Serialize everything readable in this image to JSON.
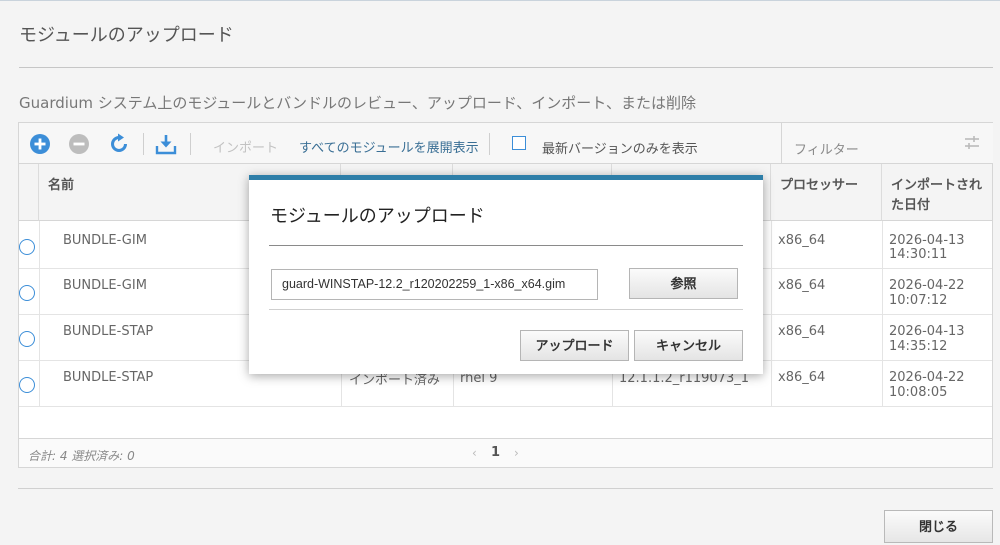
{
  "page": {
    "title": "モジュールのアップロード",
    "description": "Guardium システム上のモジュールとバンドルのレビュー、アップロード、インポート、または削除"
  },
  "toolbar": {
    "import_label": "インポート",
    "expand_all_label": "すべてのモジュールを展開表示",
    "latest_only_label": "最新バージョンのみを表示",
    "filter_placeholder": "フィルター",
    "icons": [
      "add-icon",
      "remove-icon",
      "refresh-icon",
      "download-icon",
      "filter-toggle-icon"
    ]
  },
  "table": {
    "columns": [
      "名前",
      "",
      "",
      "",
      "プロセッサー",
      "インポートされた日付"
    ],
    "rows": [
      {
        "name": "BUNDLE-GIM",
        "status": "",
        "os": "",
        "version": "",
        "processor": "x86_64",
        "date": "2026-04-13",
        "time": "14:30:11"
      },
      {
        "name": "BUNDLE-GIM",
        "status": "",
        "os": "",
        "version": "",
        "processor": "x86_64",
        "date": "2026-04-22",
        "time": "10:07:12"
      },
      {
        "name": "BUNDLE-STAP",
        "status": "",
        "os": "",
        "version": "",
        "processor": "x86_64",
        "date": "2026-04-13",
        "time": "14:35:12"
      },
      {
        "name": "BUNDLE-STAP",
        "status": "インポート済み",
        "os": "rhel 9",
        "version": "12.1.1.2_r119073_1",
        "processor": "x86_64",
        "date": "2026-04-22",
        "time": "10:08:05"
      }
    ]
  },
  "footer": {
    "summary": "合計: 4 選択済み: 0",
    "prev": "‹",
    "page": "1",
    "next": "›"
  },
  "close_button": "閉じる",
  "dialog": {
    "title": "モジュールのアップロード",
    "file_value": "guard-WINSTAP-12.2_r120202259_1-x86_x64.gim",
    "browse_label": "参照",
    "upload_label": "アップロード",
    "cancel_label": "キャンセル"
  },
  "colors": {
    "accent_blue": "#3c8ed8",
    "dialog_border": "#2e7ea8",
    "disabled_gray": "#bdbdbd"
  }
}
